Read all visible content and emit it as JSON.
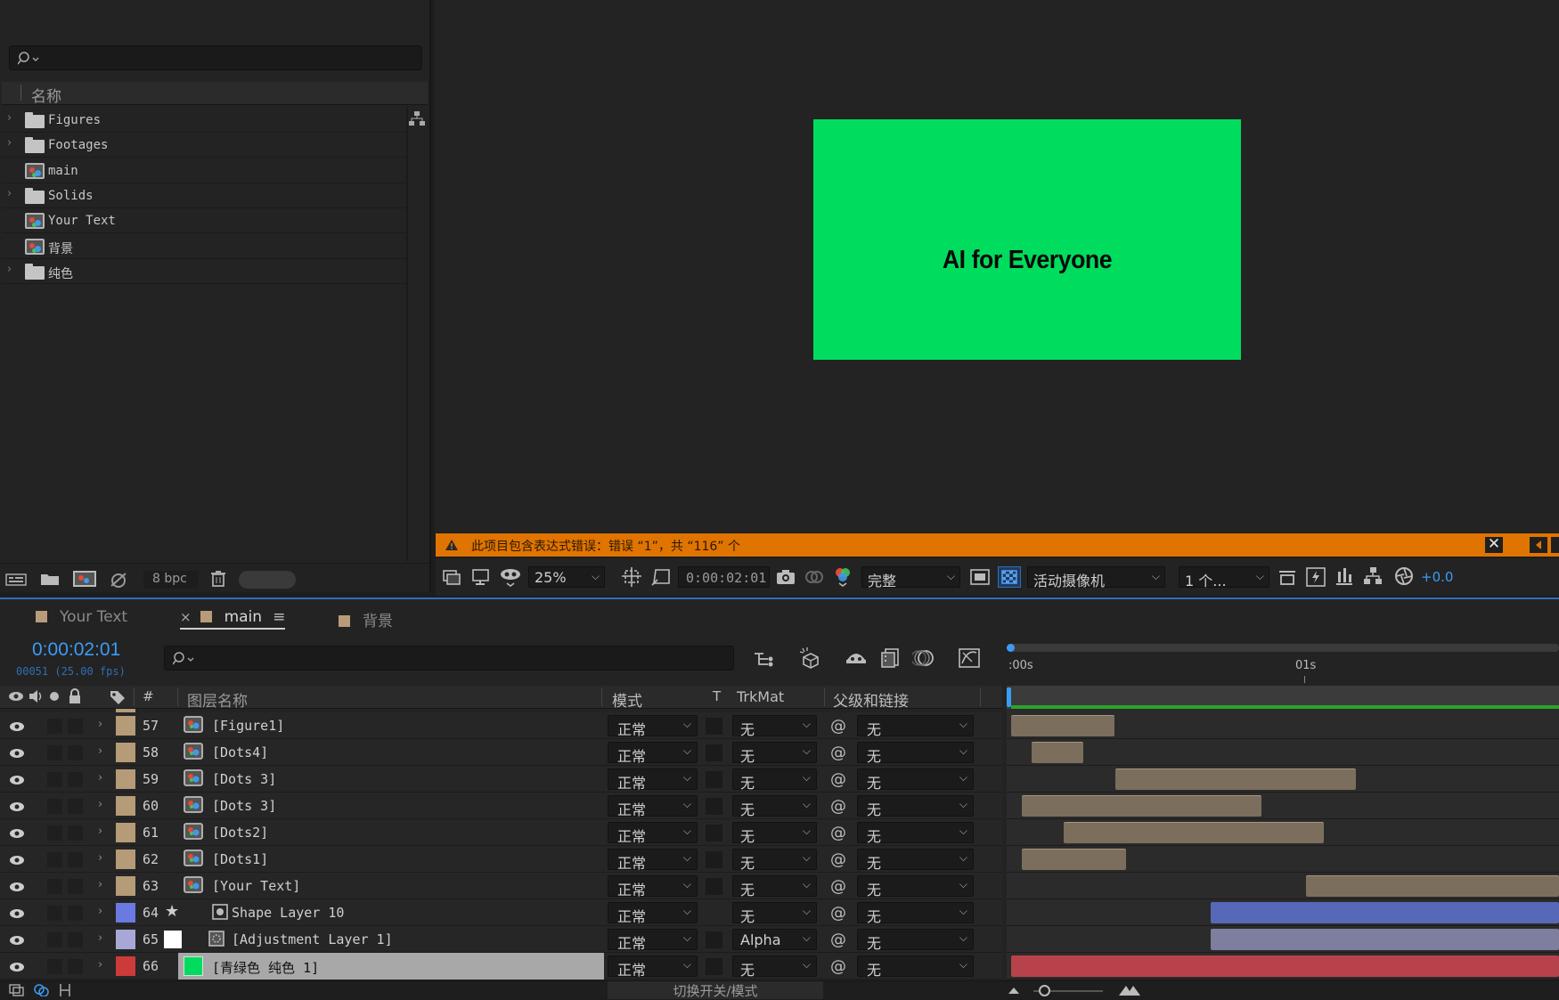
{
  "project": {
    "header_label": "名称",
    "items": [
      {
        "label": "Figures",
        "type": "folder",
        "expandable": true
      },
      {
        "label": "Footages",
        "type": "folder",
        "expandable": true
      },
      {
        "label": "main",
        "type": "comp",
        "expandable": false
      },
      {
        "label": "Solids",
        "type": "folder",
        "expandable": true
      },
      {
        "label": "Your Text",
        "type": "comp",
        "expandable": false
      },
      {
        "label": "背景",
        "type": "comp",
        "expandable": false
      },
      {
        "label": "纯色",
        "type": "folder",
        "expandable": true
      }
    ],
    "bpc": "8 bpc"
  },
  "viewer": {
    "comp_text": "AI for Everyone",
    "comp_bg_color": "#00dd5e",
    "warning": "此项目包含表达式错误：错误 “1”，共 “116” 个",
    "zoom": "25%",
    "timecode": "0:00:02:01",
    "resolution": "完整",
    "camera": "活动摄像机",
    "views": "1 个...",
    "exposure": "+0.0"
  },
  "timeline": {
    "tabs": [
      {
        "label": "Your Text",
        "active": false
      },
      {
        "label": "main",
        "active": true,
        "close": "×"
      },
      {
        "label": "背景",
        "active": false
      }
    ],
    "timecode": "0:00:02:01",
    "frames": "00051 (25.00 fps)",
    "columns": {
      "num": "#",
      "name": "图层名称",
      "mode": "模式",
      "t": "T",
      "trkmat": "TrkMat",
      "parent": "父级和链接"
    },
    "ruler": {
      "start": ":00s",
      "mark": "01s"
    },
    "layers": [
      {
        "num": "57",
        "name": "[Figure1]",
        "mode": "正常",
        "trkmat": "无",
        "parent": "无",
        "color": "#b59b78"
      },
      {
        "num": "58",
        "name": "[Dots4]",
        "mode": "正常",
        "trkmat": "无",
        "parent": "无",
        "color": "#b59b78"
      },
      {
        "num": "59",
        "name": "[Dots 3]",
        "mode": "正常",
        "trkmat": "无",
        "parent": "无",
        "color": "#b59b78"
      },
      {
        "num": "60",
        "name": "[Dots 3]",
        "mode": "正常",
        "trkmat": "无",
        "parent": "无",
        "color": "#b59b78"
      },
      {
        "num": "61",
        "name": "[Dots2]",
        "mode": "正常",
        "trkmat": "无",
        "parent": "无",
        "color": "#b59b78"
      },
      {
        "num": "62",
        "name": "[Dots1]",
        "mode": "正常",
        "trkmat": "无",
        "parent": "无",
        "color": "#b59b78"
      },
      {
        "num": "63",
        "name": "[Your Text]",
        "mode": "正常",
        "trkmat": "无",
        "parent": "无",
        "color": "#b59b78"
      },
      {
        "num": "64",
        "name": "Shape Layer 10",
        "mode": "正常",
        "trkmat": "无",
        "parent": "无",
        "color": "#6a7ae0"
      },
      {
        "num": "65",
        "name": "[Adjustment Layer 1]",
        "mode": "正常",
        "trkmat": "Alpha",
        "parent": "无",
        "color": "#a8a8d8"
      },
      {
        "num": "66",
        "name": "[青绿色 纯色 1]",
        "mode": "正常",
        "trkmat": "无",
        "parent": "无",
        "color": "#cc3a3a"
      }
    ],
    "footer_label": "切换开关/模式"
  }
}
